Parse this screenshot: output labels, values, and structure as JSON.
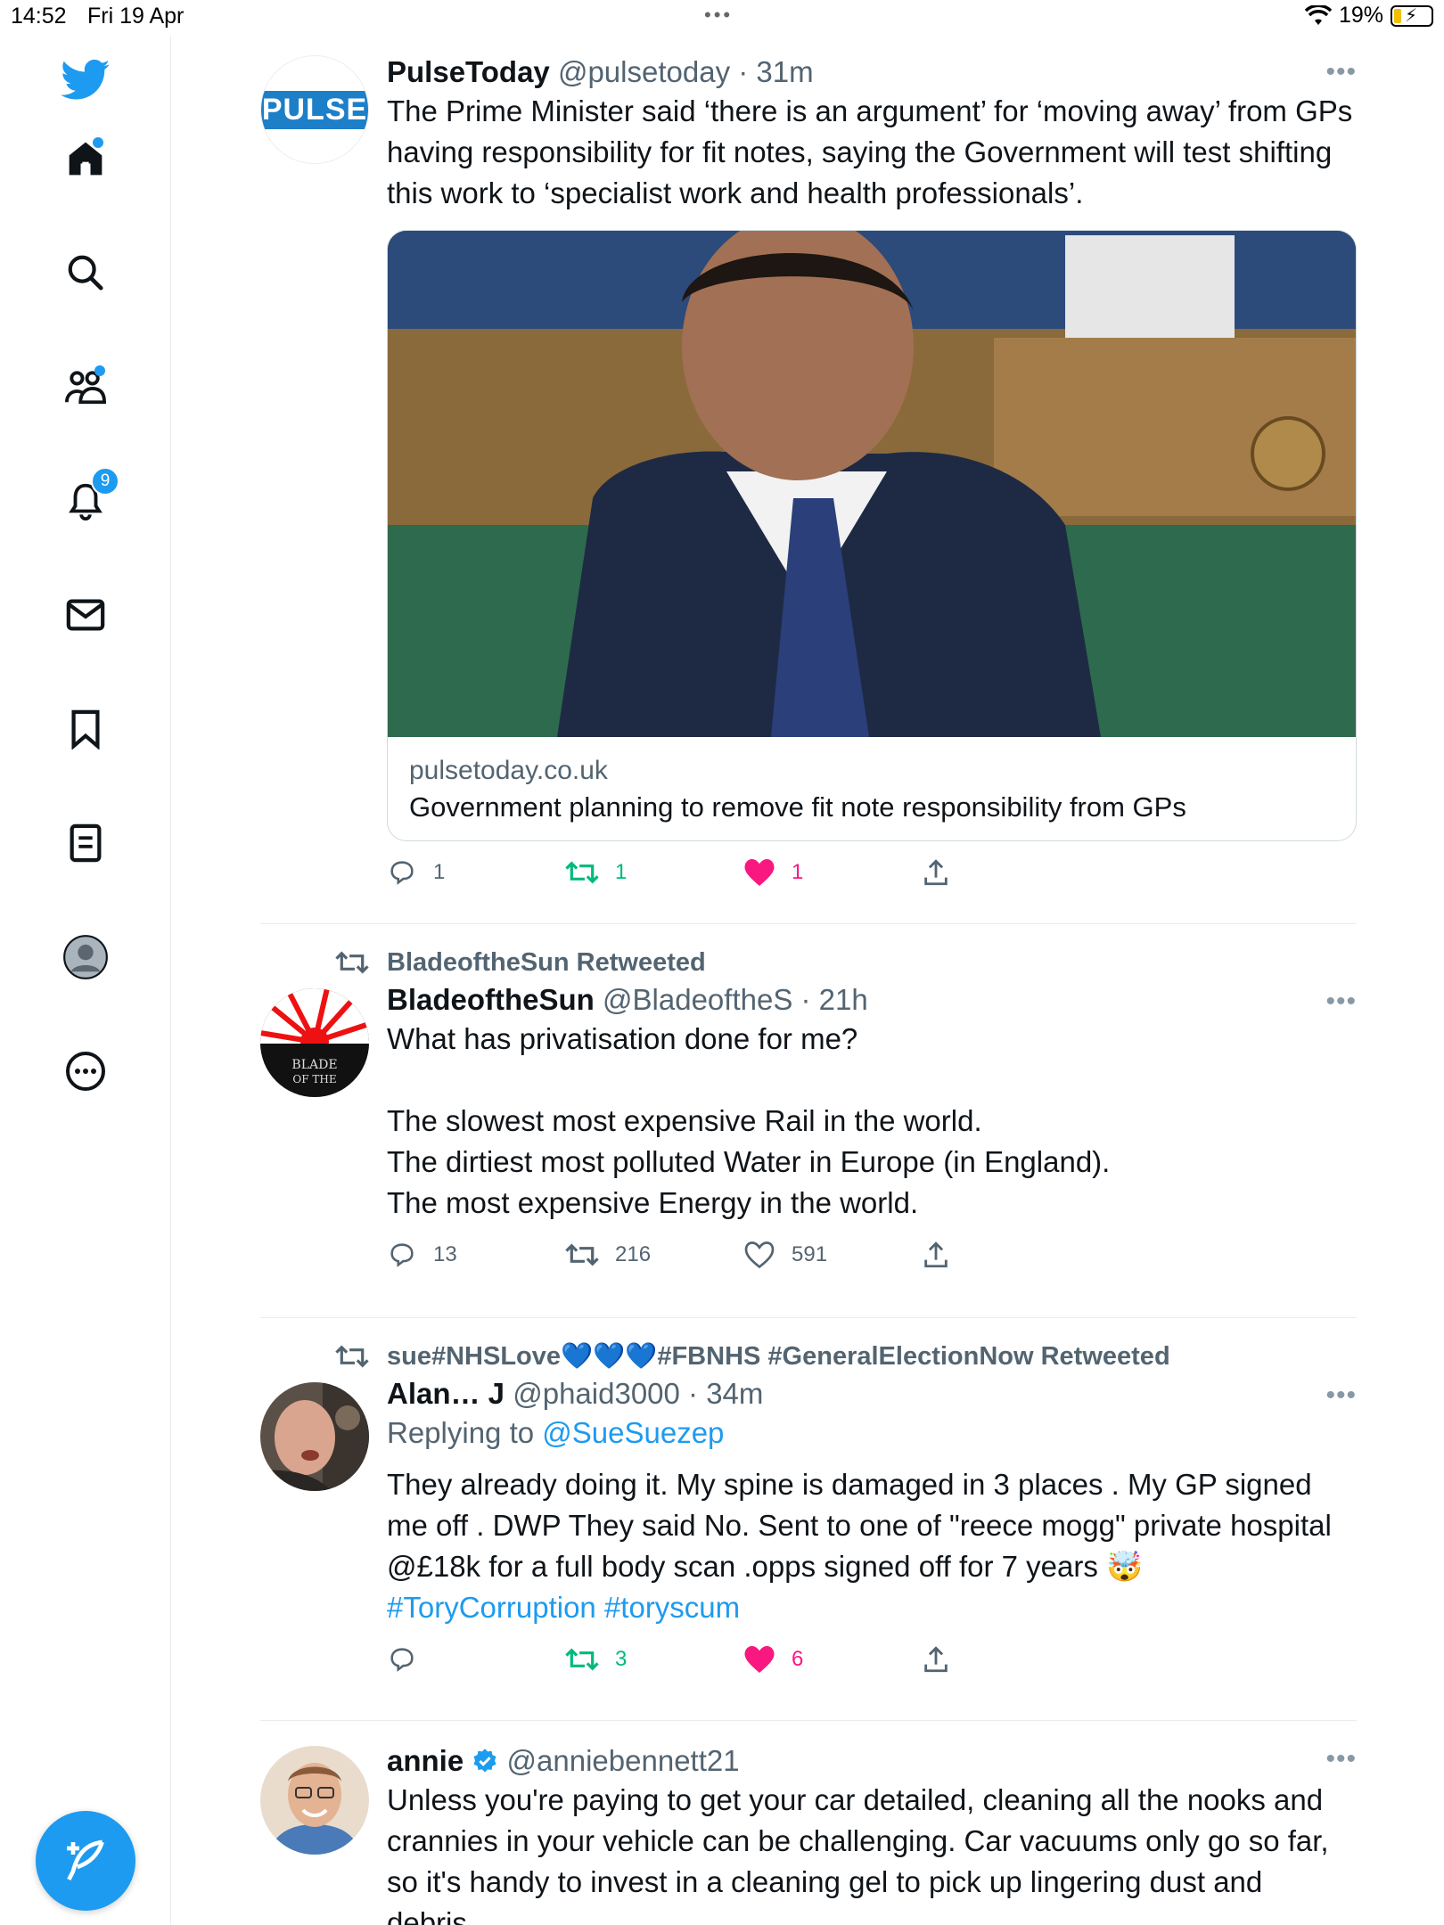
{
  "status_bar": {
    "time": "14:52",
    "date": "Fri 19 Apr",
    "battery": "19%",
    "icons": [
      "wifi-icon",
      "battery-charging-icon"
    ]
  },
  "sidebar": {
    "items": [
      {
        "name": "twitter-logo",
        "icon": "twitter-bird-icon"
      },
      {
        "name": "home",
        "icon": "home-icon"
      },
      {
        "name": "explore",
        "icon": "search-icon"
      },
      {
        "name": "communities",
        "icon": "communities-icon"
      },
      {
        "name": "notifications",
        "icon": "bell-icon",
        "badge": "9"
      },
      {
        "name": "messages",
        "icon": "mail-icon"
      },
      {
        "name": "bookmarks",
        "icon": "bookmark-icon"
      },
      {
        "name": "lists",
        "icon": "list-icon"
      },
      {
        "name": "profile",
        "icon": "profile-icon"
      },
      {
        "name": "more",
        "icon": "more-circle-icon"
      }
    ],
    "compose_icon": "compose-feather-icon",
    "accent_color": "#1d9bf0"
  },
  "tweets": [
    {
      "name": "PulseToday",
      "handle": "@pulsetoday",
      "time": "31m",
      "avatar_text": "PULSE",
      "text": "The Prime Minister said ‘there is an argument’ for ‘moving away’ from GPs having responsibility for fit notes, saying the Government will test shifting this work to ‘specialist work and health professionals’.",
      "card": {
        "domain": "pulsetoday.co.uk",
        "title": "Government planning to remove fit note responsibility from GPs"
      },
      "replies": "1",
      "retweets": "1",
      "likes": "1"
    },
    {
      "retweeted_by": "BladeoftheSun Retweeted",
      "name": "BladeoftheSun",
      "handle": "@BladeoftheS",
      "time": "21h",
      "avatar_text": "BLADE OF THE SUN",
      "text": "What has privatisation done for me?\n\nThe slowest most expensive Rail in the world.\nThe dirtiest most polluted Water in Europe (in England).\nThe most expensive Energy in the world.",
      "replies": "13",
      "retweets": "216",
      "likes": "591"
    },
    {
      "retweeted_by": "sue#NHSLove💙💙💙#FBNHS #GeneralElectionNow Retweeted",
      "name": "Alan… J",
      "handle": "@phaid3000",
      "time": "34m",
      "replying_label": "Replying to ",
      "replying_to": "@SueSuezep",
      "text": "They already doing it.  My spine is damaged in 3 places . My GP signed me off . DWP They said No. Sent to one of \"reece mogg\" private hospital @£18k for a full body scan .opps signed off for 7 years 🤯",
      "hashtags": "#ToryCorruption #toryscum",
      "replies": "",
      "retweets": "3",
      "likes": "6"
    },
    {
      "name": "annie",
      "handle": "@anniebennett21",
      "verified": true,
      "text": "Unless you're paying to get your car detailed, cleaning all the nooks and crannies in your vehicle can be challenging. Car vacuums only go so far, so it's handy to invest in a cleaning gel to pick up lingering dust and debris."
    }
  ],
  "colors": {
    "retweet_active": "#00ba7c",
    "like_active": "#f91880",
    "muted": "#536471"
  }
}
